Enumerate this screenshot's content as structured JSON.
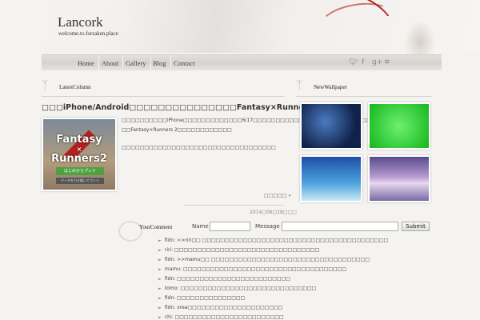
{
  "header": {
    "logo": "Lancork",
    "tagline": "welcome.to.forsaken.place"
  },
  "nav": [
    "Home",
    "About",
    "Gallery",
    "Blog",
    "Contact"
  ],
  "social": {
    "twitter": "twitter-icon",
    "facebook": "facebook-icon",
    "gplus": "google-plus-icon",
    "rss": "rss-icon"
  },
  "latest": {
    "heading": "LatestColumn",
    "title": "□□□iPhone/Android□□□□□□□□□□□□□□□Fantasy×Runners 2□□□□□",
    "thumb": {
      "game_title_1": "Fantasy",
      "game_title_2": "×",
      "game_title_3": "Runners2",
      "btn1": "はじめからプレイ",
      "btn2": "データを引き継いでプレイ"
    },
    "text1": "□□□□□□□□□□iPhone□□□□□□□□□□□□□6/17□□□□□□□□□□□□□□□□□□□□□□□□□□□",
    "text2": "□□Fantasy×Runners 2□□□□□□□□□□□□",
    "text3": "□□□□□□□□□□□□□□□□□□□□□□□□□□□□□□□□□□",
    "more": "□□□□□ »",
    "date": "2014□06□18□□□"
  },
  "wallpaper": {
    "heading": "NewWallpaper"
  },
  "comment": {
    "heading": "YourComment",
    "name_label": "Name",
    "message_label": "Message",
    "submit": "Submit",
    "name_value": "",
    "message_value": "",
    "items": [
      "fidn: >>riri□□ □□□□□□□□□□□□□□□□□□□□□□□□□□□□□□□□□□□□□□□□□",
      "riri: □□□□□□□□□□□□□□□□□□□□□□□□□□□□□□□□",
      "fidn: >>mamu□□ □□□□□□□□□□□□□□□□□□□□□□□□□□□□□□□□□□□",
      "mamu: □□□□□□□□□□□□□□□□□□□□□□□□□□□□□□□□□□□□",
      "fidn: □□□□□□□□□□□□□□□□□□□□□□□□□",
      "tomo: □□□□□□□□□□□□□□□□□□□□□□□□□□□□□□",
      "fidn: □□□□□□□□□□□□□□□",
      "fidn: xrea□□□□□□□□□□□□□□□□□□□□□",
      "chi: □□□□□□□□□□□□□□□□□□□□□□□□"
    ]
  }
}
